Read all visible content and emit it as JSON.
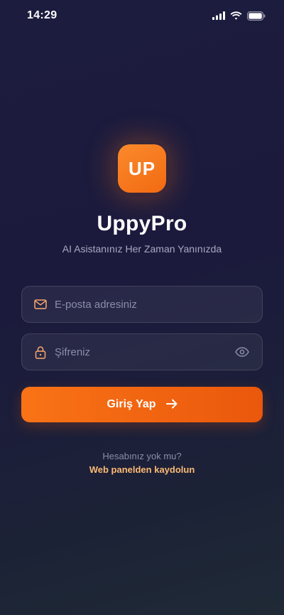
{
  "status_bar": {
    "time": "14:29",
    "icons": [
      "signal-icon",
      "wifi-icon",
      "battery-icon"
    ]
  },
  "logo": {
    "text": "UP",
    "color": "#f97316"
  },
  "app": {
    "name": "UppyPro",
    "tagline": "AI Asistanınız Her Zaman Yanınızda"
  },
  "form": {
    "email": {
      "placeholder": "E-posta adresiniz",
      "value": "",
      "icon": "mail-icon"
    },
    "password": {
      "placeholder": "Şifreniz",
      "value": "",
      "icon": "lock-icon",
      "toggle_icon": "eye-icon"
    },
    "submit": {
      "label": "Giriş Yap",
      "icon": "arrow-right-icon"
    }
  },
  "footer": {
    "question": "Hesabınız yok mu?",
    "register_link": "Web panelden kaydolun"
  },
  "colors": {
    "accent": "#f97316",
    "link": "#fdba74",
    "background": "#1c1c3e",
    "muted_text": "#8b8ea8"
  }
}
